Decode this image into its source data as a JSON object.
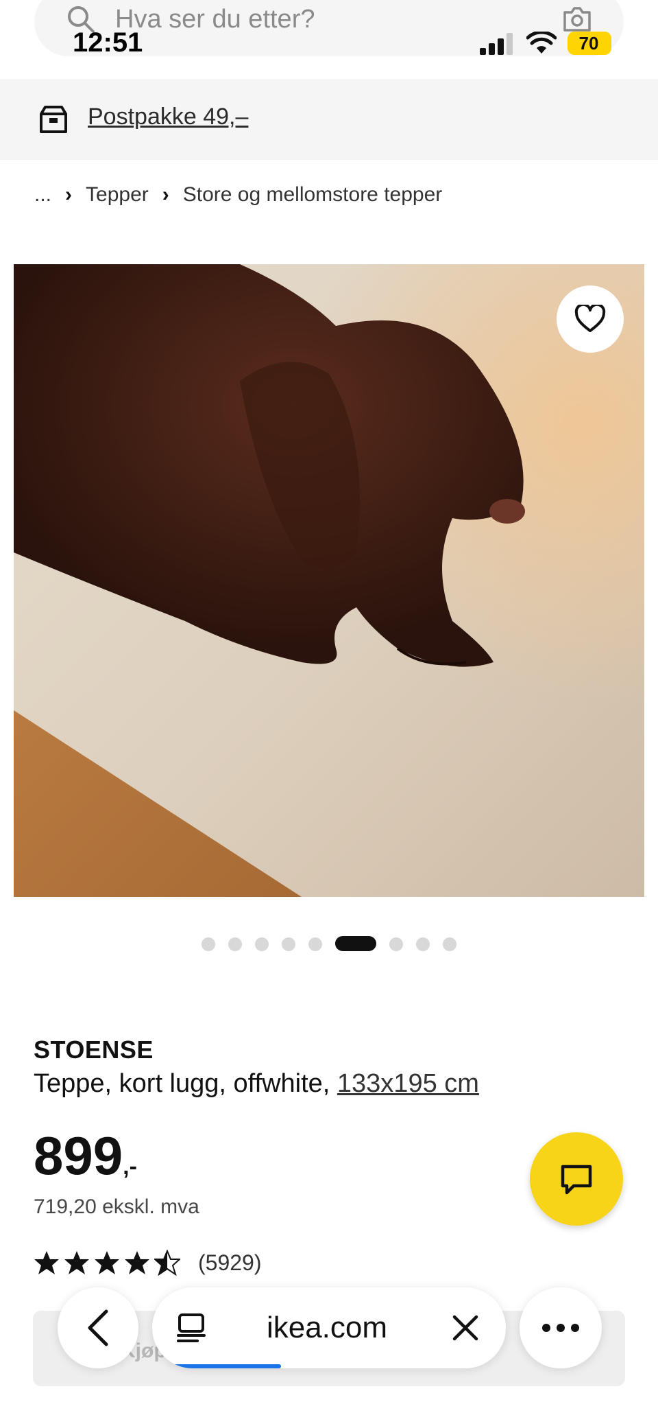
{
  "search": {
    "placeholder": "Hva ser du etter?"
  },
  "status_bar": {
    "time": "12:51",
    "battery": "70"
  },
  "delivery": {
    "label": "Postpakke 49,–"
  },
  "breadcrumb": {
    "ellipsis": "...",
    "items": [
      "Tepper",
      "Store og mellomstore tepper"
    ]
  },
  "carousel": {
    "total": 9,
    "active_index": 5
  },
  "product": {
    "name": "STOENSE",
    "description": "Teppe, kort lugg, offwhite, ",
    "size": "133x195 cm",
    "price": "899",
    "price_suffix": ",-",
    "price_ex_vat": "719,20 ekskl. mva",
    "rating_value": 4.5,
    "rating_count": "(5929)"
  },
  "buy_bar": {
    "label": "Kjøp"
  },
  "browser": {
    "url": "ikea.com",
    "load_progress": 0.35
  },
  "colors": {
    "accent": "#f7d417",
    "progress": "#1a73e8",
    "delivery_bg": "#f5f5f5"
  }
}
